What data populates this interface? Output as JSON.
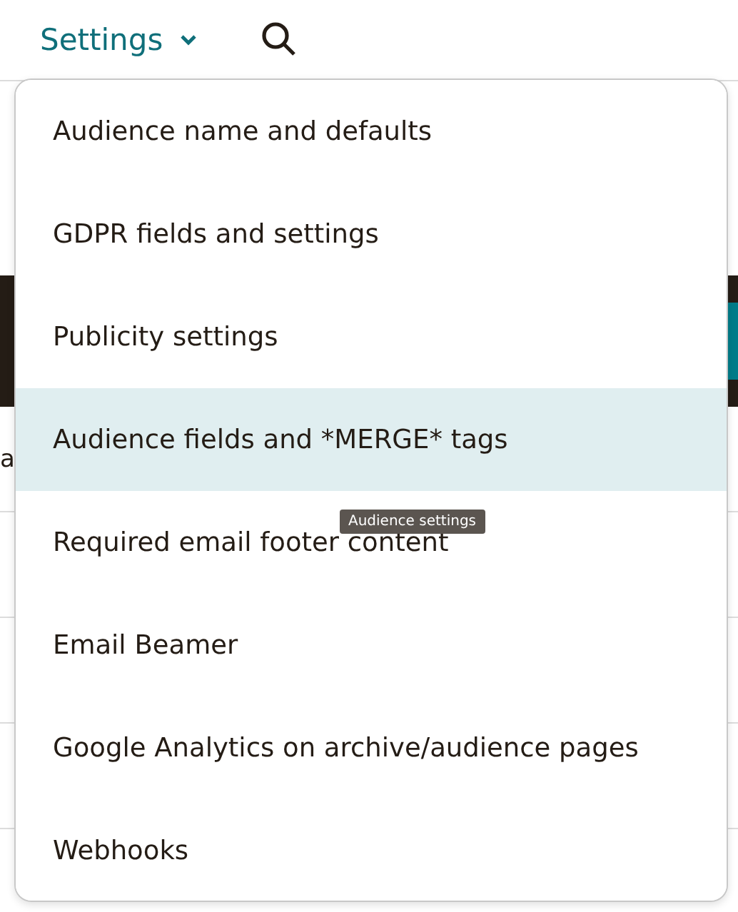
{
  "header": {
    "title": "Settings"
  },
  "background": {
    "row": {
      "left_text": "a"
    }
  },
  "menu": {
    "items": [
      {
        "label": "Audience name and defaults",
        "selected": false
      },
      {
        "label": "GDPR fields and settings",
        "selected": false
      },
      {
        "label": "Publicity settings",
        "selected": false
      },
      {
        "label": "Audience fields and *MERGE* tags",
        "selected": true
      },
      {
        "label": "Required email footer content",
        "selected": false
      },
      {
        "label": "Email Beamer",
        "selected": false
      },
      {
        "label": "Google Analytics on archive/audience pages",
        "selected": false
      },
      {
        "label": "Webhooks",
        "selected": false
      }
    ]
  },
  "tooltip": {
    "text": "Audience settings"
  }
}
